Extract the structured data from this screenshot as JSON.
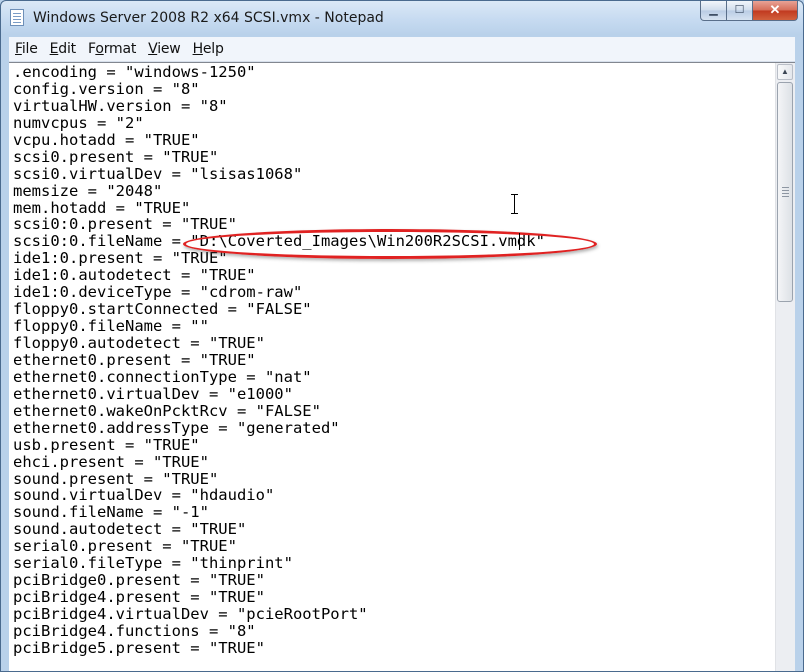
{
  "window": {
    "title": "Windows Server 2008 R2 x64 SCSI.vmx - Notepad",
    "icon": "notepad-icon"
  },
  "caption_buttons": {
    "minimize_glyph": "▁",
    "maximize_glyph": "☐",
    "close_glyph": "✕"
  },
  "menu": [
    {
      "first": "F",
      "rest": "ile"
    },
    {
      "first": "E",
      "rest": "dit"
    },
    {
      "first": "F",
      "rest": "ormat",
      "underline_index": 1
    },
    {
      "first": "V",
      "rest": "iew"
    },
    {
      "first": "H",
      "rest": "elp"
    }
  ],
  "editor": {
    "lines": [
      ".encoding = \"windows-1250\"",
      "config.version = \"8\"",
      "virtualHW.version = \"8\"",
      "numvcpus = \"2\"",
      "vcpu.hotadd = \"TRUE\"",
      "scsi0.present = \"TRUE\"",
      "scsi0.virtualDev = \"lsisas1068\"",
      "memsize = \"2048\"",
      "mem.hotadd = \"TRUE\"",
      "scsi0:0.present = \"TRUE\"",
      "scsi0:0.fileName = \"D:\\Coverted_Images\\Win200R2SCSI.vmdk\"",
      "ide1:0.present = \"TRUE\"",
      "ide1:0.autodetect = \"TRUE\"",
      "ide1:0.deviceType = \"cdrom-raw\"",
      "floppy0.startConnected = \"FALSE\"",
      "floppy0.fileName = \"\"",
      "floppy0.autodetect = \"TRUE\"",
      "ethernet0.present = \"TRUE\"",
      "ethernet0.connectionType = \"nat\"",
      "ethernet0.virtualDev = \"e1000\"",
      "ethernet0.wakeOnPcktRcv = \"FALSE\"",
      "ethernet0.addressType = \"generated\"",
      "usb.present = \"TRUE\"",
      "ehci.present = \"TRUE\"",
      "sound.present = \"TRUE\"",
      "sound.virtualDev = \"hdaudio\"",
      "sound.fileName = \"-1\"",
      "sound.autodetect = \"TRUE\"",
      "serial0.present = \"TRUE\"",
      "serial0.fileType = \"thinprint\"",
      "pciBridge0.present = \"TRUE\"",
      "pciBridge4.present = \"TRUE\"",
      "pciBridge4.virtualDev = \"pcieRootPort\"",
      "pciBridge4.functions = \"8\"",
      "pciBridge5.present = \"TRUE\""
    ]
  },
  "annotation": {
    "color": "#e02222"
  }
}
